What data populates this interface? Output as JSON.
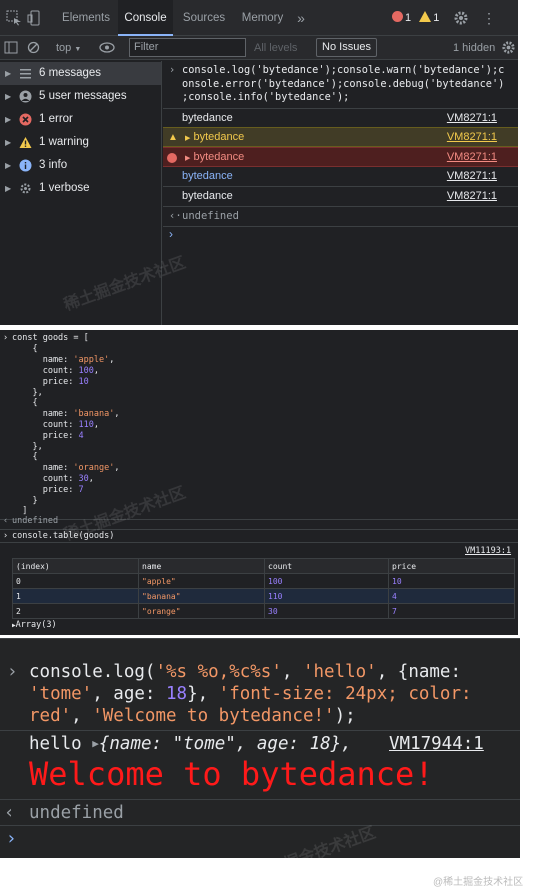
{
  "tabs": {
    "items": [
      "Elements",
      "Console",
      "Sources",
      "Memory"
    ],
    "more": "»",
    "errors": "1",
    "warnings": "1"
  },
  "toolbar": {
    "context": "top",
    "filter_placeholder": "Filter",
    "levels": "All levels",
    "issues": "No Issues",
    "hidden": "1 hidden"
  },
  "sidebar": {
    "items": [
      {
        "label": "6 messages",
        "icon": "list-icon"
      },
      {
        "label": "5 user messages",
        "icon": "user-icon"
      },
      {
        "label": "1 error",
        "icon": "error-icon"
      },
      {
        "label": "1 warning",
        "icon": "warning-icon"
      },
      {
        "label": "3 info",
        "icon": "info-icon"
      },
      {
        "label": "1 verbose",
        "icon": "verbose-icon"
      }
    ]
  },
  "console1": {
    "input": [
      "console.log('bytedance');console.warn('bytedance');c",
      "onsole.error('bytedance');console.debug('bytedance')",
      ";console.info('bytedance');"
    ],
    "rows": [
      {
        "text": "bytedance",
        "src": "VM8271:1"
      },
      {
        "text": "bytedance",
        "src": "VM8271:1"
      },
      {
        "text": "bytedance",
        "src": "VM8271:1"
      },
      {
        "text": "bytedance",
        "src": "VM8271:1"
      },
      {
        "text": "bytedance",
        "src": "VM8271:1"
      }
    ],
    "result": "undefined"
  },
  "console2": {
    "decl": "const goods = [",
    "items": [
      {
        "name": "'apple'",
        "count": "100",
        "price": "10"
      },
      {
        "name": "'banana'",
        "count": "110",
        "price": "4"
      },
      {
        "name": "'orange'",
        "count": "30",
        "price": "7"
      }
    ],
    "result": "undefined",
    "call": "console.table(goods)",
    "src": "VM11193:1",
    "headers": [
      "(index)",
      "name",
      "count",
      "price"
    ],
    "rows": [
      [
        "0",
        "\"apple\"",
        "100",
        "10"
      ],
      [
        "1",
        "\"banana\"",
        "110",
        "4"
      ],
      [
        "2",
        "\"orange\"",
        "30",
        "7"
      ]
    ],
    "array_label": "Array(3)"
  },
  "console3": {
    "src": "VM17944:1",
    "styled": "Welcome to bytedance!",
    "hello": "hello",
    "obj": "{name: \"tome\", age: 18},",
    "result": "undefined"
  },
  "watermark": "稀土掘金技术社区",
  "watermark_tag": "@稀土掘金技术社区",
  "colors": {
    "accent": "#8ab4f8",
    "warn": "#f2c94c",
    "error": "#f28b82",
    "string": "#f29766",
    "number": "#9980ff"
  }
}
